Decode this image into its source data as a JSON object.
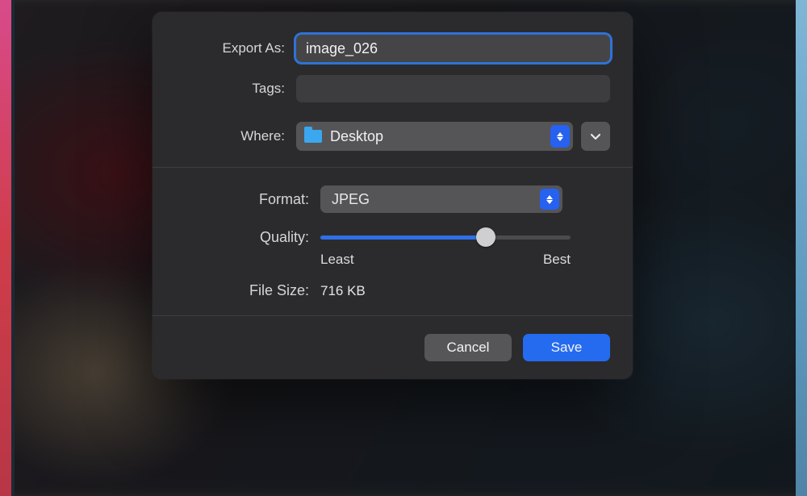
{
  "dialog": {
    "exportAs": {
      "label": "Export As:",
      "value": "image_026"
    },
    "tags": {
      "label": "Tags:",
      "value": ""
    },
    "where": {
      "label": "Where:",
      "selected": "Desktop"
    },
    "format": {
      "label": "Format:",
      "selected": "JPEG"
    },
    "quality": {
      "label": "Quality:",
      "percent": 66,
      "min_label": "Least",
      "max_label": "Best"
    },
    "fileSize": {
      "label": "File Size:",
      "value": "716 KB"
    },
    "buttons": {
      "cancel": "Cancel",
      "save": "Save"
    }
  }
}
